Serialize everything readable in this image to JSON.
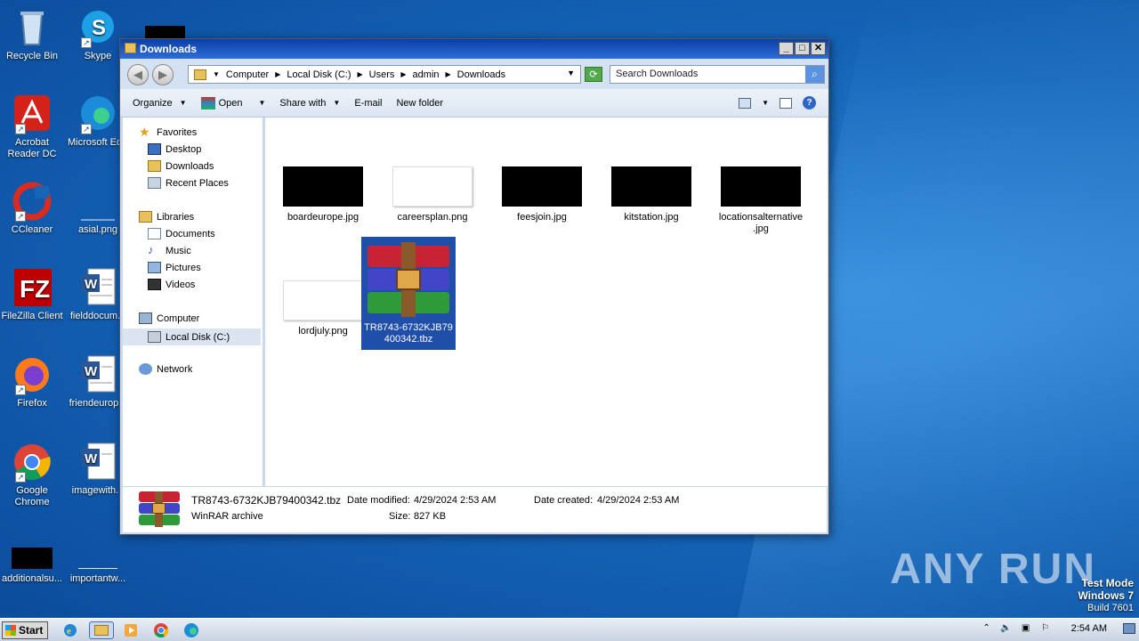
{
  "desktop": {
    "icons": [
      {
        "label": "Recycle Bin",
        "icon": "recycle-bin-icon"
      },
      {
        "label": "Skype",
        "icon": "skype-icon"
      },
      {
        "label": "Acrobat Reader DC",
        "icon": "acrobat-icon"
      },
      {
        "label": "Microsoft Ed",
        "icon": "edge-icon"
      },
      {
        "label": "CCleaner",
        "icon": "ccleaner-icon"
      },
      {
        "label": "asial.png",
        "icon": "image-file-icon"
      },
      {
        "label": "FileZilla Client",
        "icon": "filezilla-icon"
      },
      {
        "label": "fielddocum...",
        "icon": "word-doc-icon"
      },
      {
        "label": "Firefox",
        "icon": "firefox-icon"
      },
      {
        "label": "friendeurop...",
        "icon": "word-doc-icon"
      },
      {
        "label": "Google Chrome",
        "icon": "chrome-icon"
      },
      {
        "label": "imagewith...",
        "icon": "word-doc-icon"
      },
      {
        "label": "additionalsu...",
        "icon": "black-image-icon"
      },
      {
        "label": "importantw...",
        "icon": "image-file-icon"
      }
    ],
    "watermark": "ANY RUN",
    "test_mode": {
      "line1": "Test Mode",
      "line2": "Windows 7",
      "line3": "Build 7601"
    }
  },
  "window": {
    "title": "Downloads",
    "address": {
      "crumbs": [
        "Computer",
        "Local Disk (C:)",
        "Users",
        "admin",
        "Downloads"
      ]
    },
    "search_placeholder": "Search Downloads",
    "toolbar": {
      "organize": "Organize",
      "open": "Open",
      "share_with": "Share with",
      "email": "E-mail",
      "new_folder": "New folder"
    },
    "nav": {
      "favorites": "Favorites",
      "desktop": "Desktop",
      "downloads": "Downloads",
      "recent_places": "Recent Places",
      "libraries": "Libraries",
      "documents": "Documents",
      "music": "Music",
      "pictures": "Pictures",
      "videos": "Videos",
      "computer": "Computer",
      "local_disk": "Local Disk (C:)",
      "network": "Network"
    },
    "files": [
      {
        "name": "boardeurope.jpg",
        "thumb": "black"
      },
      {
        "name": "careersplan.png",
        "thumb": "white"
      },
      {
        "name": "feesjoin.jpg",
        "thumb": "black"
      },
      {
        "name": "kitstation.jpg",
        "thumb": "black"
      },
      {
        "name": "locationsalternative.jpg",
        "name_line1": "locationsalternative",
        "name_line2": ".jpg",
        "thumb": "black"
      },
      {
        "name": "lordjuly.png",
        "thumb": "white"
      },
      {
        "name": "TR8743-6732KJB79400342.tbz",
        "name_line1": "TR8743-6732KJB79",
        "name_line2": "400342.tbz",
        "thumb": "winrar",
        "selected": true
      }
    ],
    "details": {
      "filename": "TR8743-6732KJB79400342.tbz",
      "type": "WinRAR archive",
      "date_modified_label": "Date modified:",
      "date_modified": "4/29/2024 2:53 AM",
      "date_created_label": "Date created:",
      "date_created": "4/29/2024 2:53 AM",
      "size_label": "Size:",
      "size": "827 KB"
    }
  },
  "taskbar": {
    "start_label": "Start",
    "clock": "2:54 AM",
    "pinned": [
      "internet-explorer-icon",
      "explorer-icon",
      "media-player-icon",
      "chrome-icon",
      "edge-icon"
    ]
  },
  "colors": {
    "selection": "#1f4fa8",
    "titlebar": "#0b3fa6",
    "desktop": "#1565b9"
  }
}
